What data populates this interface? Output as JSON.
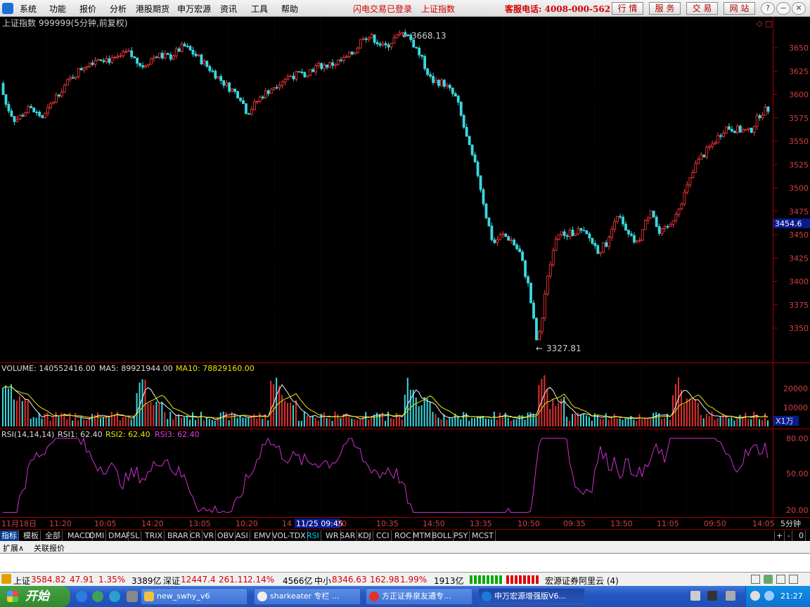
{
  "menu": {
    "items": [
      "系统",
      "功能",
      "报价",
      "分析",
      "港股期货",
      "申万宏源",
      "资讯",
      "工具",
      "帮助"
    ],
    "flash_trade": "闪电交易已登录",
    "current_index": "上证指数",
    "hotline": "客服电话: 4008-000-562",
    "buttons": [
      "行 情",
      "服 务",
      "交 易",
      "网 站"
    ]
  },
  "chart_header": {
    "title": "上证指数 999999(5分钟,前复权)",
    "high_label": "3668.13",
    "low_label": "3327.81",
    "current_price_tag": "3454.6"
  },
  "price_axis": {
    "ticks": [
      "3650",
      "3625",
      "3600",
      "3575",
      "3550",
      "3525",
      "3500",
      "3475",
      "3450",
      "3425",
      "3400",
      "3375",
      "3350"
    ]
  },
  "volume": {
    "label": "VOLUME: 140552416.00",
    "ma5": "MA5: 89921944.00",
    "ma10": "MA10: 78829160.00",
    "ticks": [
      "20000",
      "10000"
    ],
    "unit": "X1万"
  },
  "rsi": {
    "label": "RSI(14,14,14)",
    "rsi1": "RSI1: 62.40",
    "rsi2": "RSI2: 62.40",
    "rsi3": "RSI3: 62.40",
    "ticks": [
      "80.00",
      "50.00",
      "20.00"
    ]
  },
  "time_axis": {
    "labels": [
      "11月18日",
      "11:20",
      "10:05",
      "14:20",
      "13:05",
      "10:20",
      "14",
      "11/25 09:45",
      "20",
      "10:35",
      "14:50",
      "13:35",
      "10:50",
      "09:35",
      "13:50",
      "11:05",
      "09:50",
      "14:05"
    ],
    "period": "5分钟"
  },
  "chart_data": {
    "type": "candlestick",
    "price_range": [
      3327.81,
      3668.13
    ],
    "path": [
      [
        0,
        3612
      ],
      [
        5,
        3592
      ],
      [
        20,
        3572
      ],
      [
        40,
        3585
      ],
      [
        60,
        3575
      ],
      [
        80,
        3600
      ],
      [
        100,
        3618
      ],
      [
        120,
        3632
      ],
      [
        140,
        3640
      ],
      [
        160,
        3636
      ],
      [
        180,
        3645
      ],
      [
        200,
        3630
      ],
      [
        220,
        3642
      ],
      [
        240,
        3640
      ],
      [
        260,
        3652
      ],
      [
        280,
        3640
      ],
      [
        300,
        3625
      ],
      [
        320,
        3610
      ],
      [
        340,
        3598
      ],
      [
        350,
        3580
      ],
      [
        370,
        3598
      ],
      [
        390,
        3610
      ],
      [
        410,
        3620
      ],
      [
        430,
        3622
      ],
      [
        450,
        3630
      ],
      [
        470,
        3632
      ],
      [
        490,
        3638
      ],
      [
        505,
        3648
      ],
      [
        515,
        3663
      ],
      [
        530,
        3660
      ],
      [
        545,
        3650
      ],
      [
        560,
        3660
      ],
      [
        575,
        3667
      ],
      [
        590,
        3650
      ],
      [
        600,
        3635
      ],
      [
        612,
        3615
      ],
      [
        630,
        3612
      ],
      [
        648,
        3595
      ],
      [
        665,
        3545
      ],
      [
        678,
        3515
      ],
      [
        690,
        3470
      ],
      [
        700,
        3440
      ],
      [
        712,
        3450
      ],
      [
        725,
        3445
      ],
      [
        738,
        3430
      ],
      [
        750,
        3395
      ],
      [
        763,
        3330
      ],
      [
        775,
        3395
      ],
      [
        790,
        3450
      ],
      [
        805,
        3450
      ],
      [
        820,
        3455
      ],
      [
        835,
        3448
      ],
      [
        850,
        3432
      ],
      [
        865,
        3445
      ],
      [
        875,
        3475
      ],
      [
        890,
        3450
      ],
      [
        905,
        3440
      ],
      [
        925,
        3480
      ],
      [
        935,
        3450
      ],
      [
        950,
        3458
      ],
      [
        970,
        3490
      ],
      [
        990,
        3528
      ],
      [
        1010,
        3545
      ],
      [
        1030,
        3565
      ],
      [
        1050,
        3562
      ],
      [
        1065,
        3560
      ],
      [
        1080,
        3580
      ],
      [
        1092,
        3585
      ]
    ],
    "volume_ticks": [
      20000,
      10000
    ],
    "rsi_ticks": [
      80,
      50,
      20
    ],
    "rsi1": 62.4,
    "rsi2": 62.4,
    "rsi3": 62.4
  },
  "indicator_tabs": [
    "指标",
    "模板",
    "全部",
    "MACD",
    "DMI",
    "DMA",
    "FSL",
    "TRIX",
    "BRAR",
    "CR",
    "VR",
    "OBV",
    "ASI",
    "EMV",
    "VOL-TDX",
    "RSI",
    "WR",
    "SAR",
    "KDJ",
    "CCI",
    "ROC",
    "MTM",
    "BOLL",
    "PSY",
    "MCST"
  ],
  "bottom_tabs": [
    "扩展∧",
    "关联报价"
  ],
  "status": {
    "sh_label": "上证",
    "sh_value": "3584.82",
    "sh_change": "47.91",
    "sh_pct": "1.35%",
    "sh_amount": "3389亿",
    "sz_label": "深证",
    "sz_value": "12447.4",
    "sz_change": "261.11",
    "sz_pct": "2.14%",
    "sz_amount": "4566亿",
    "sm_label": "中小",
    "sm_value": "8346.63",
    "sm_change": "162.98",
    "sm_pct": "1.99%",
    "sm_amount": "1913亿",
    "server": "宏源证券阿里云 (4)"
  },
  "taskbar": {
    "start": "开始",
    "windows": [
      "new_swhy_v6",
      "sharkeater 专栏 ...",
      "方正证券泉友通专...",
      "申万宏源增强版V6..."
    ],
    "clock": "21:27"
  }
}
